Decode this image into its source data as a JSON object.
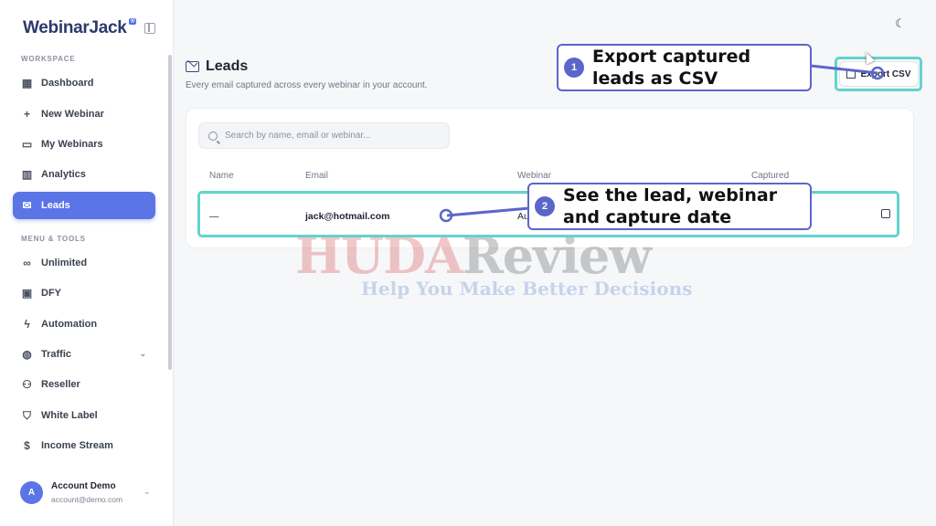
{
  "app": {
    "logo": "WebinarJack",
    "logo_badge": "®"
  },
  "sidebar": {
    "workspace_label": "WORKSPACE",
    "tools_label": "MENU & TOOLS",
    "items": [
      {
        "label": "Dashboard",
        "icon": "grid-icon"
      },
      {
        "label": "New Webinar",
        "icon": "plus-icon"
      },
      {
        "label": "My Webinars",
        "icon": "monitor-icon"
      },
      {
        "label": "Analytics",
        "icon": "bar-chart-icon"
      },
      {
        "label": "Leads",
        "icon": "mail-icon",
        "active": true
      }
    ],
    "tools": [
      {
        "label": "Unlimited",
        "icon": "infinity-icon"
      },
      {
        "label": "DFY",
        "icon": "gift-icon"
      },
      {
        "label": "Automation",
        "icon": "bolt-icon"
      },
      {
        "label": "Traffic",
        "icon": "globe-icon"
      },
      {
        "label": "Reseller",
        "icon": "users-icon"
      },
      {
        "label": "White Label",
        "icon": "shield-icon"
      },
      {
        "label": "Income Stream",
        "icon": "dollar-icon"
      }
    ],
    "account": {
      "initial": "A",
      "name": "Account Demo",
      "email": "account@demo.com"
    }
  },
  "page": {
    "title": "Leads",
    "subtitle": "Every email captured across every webinar in your account.",
    "export_label": "Export CSV",
    "search_placeholder": "Search by name, email or webinar...",
    "columns": [
      "Name",
      "Email",
      "Webinar",
      "Captured"
    ],
    "rows": [
      {
        "name": "—",
        "email": "jack@hotmail.com",
        "webinar": "Au",
        "captured": ""
      }
    ]
  },
  "annotations": {
    "callout1": {
      "num": "1",
      "text_line1": "Export captured",
      "text_line2": "leads as CSV"
    },
    "callout2": {
      "num": "2",
      "text_line1": "See the lead, webinar",
      "text_line2": "and capture date"
    }
  },
  "watermark": {
    "red": "HUDA",
    "grey": "Review",
    "tagline": "Help You Make Better Decisions"
  },
  "colors": {
    "accent": "#5b75e6",
    "annotation": "#5b66c9",
    "highlight": "#62d3cf"
  }
}
